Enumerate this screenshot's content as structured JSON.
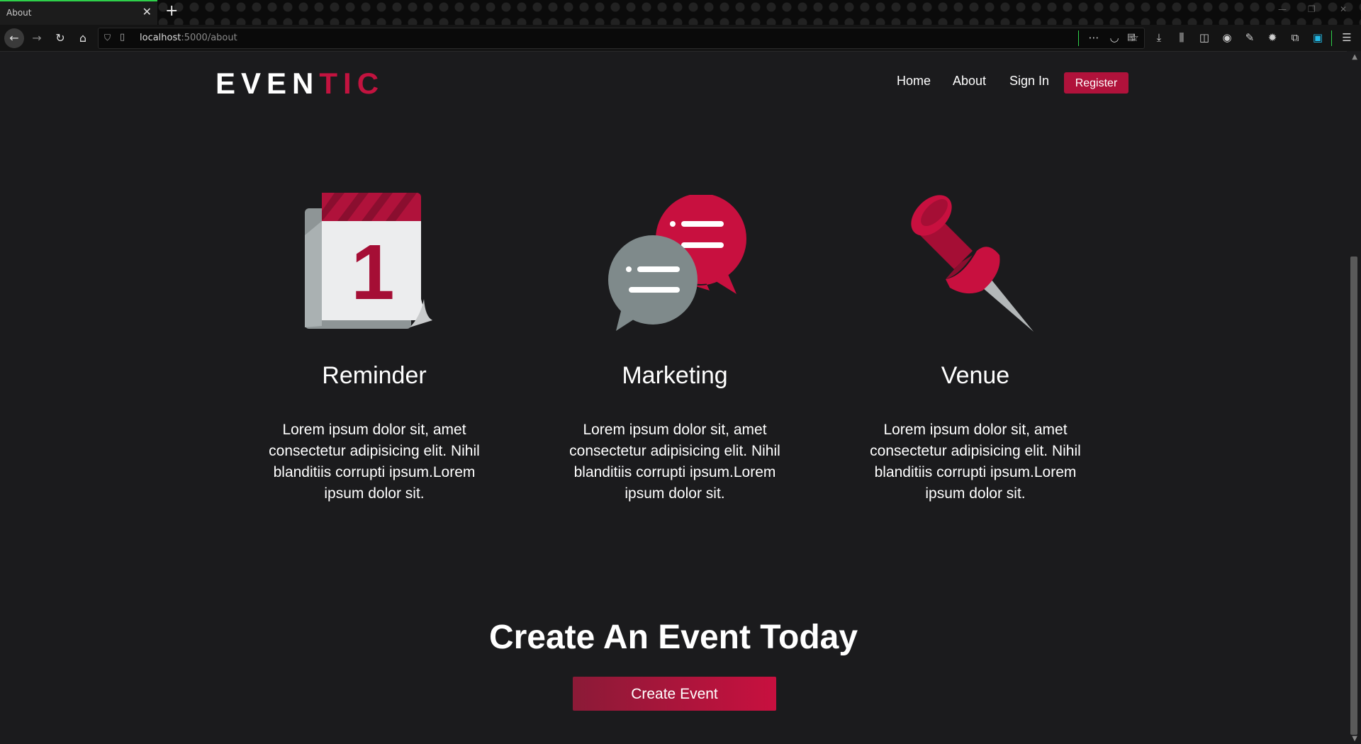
{
  "browser": {
    "tab_title": "About",
    "tab_close": "✕",
    "new_tab": "+",
    "url_host": "localhost",
    "url_path": ":5000/about"
  },
  "brand": {
    "logo_part1": "EVEN",
    "logo_part2": "TIC",
    "accent": "#c2133f"
  },
  "nav": {
    "items": [
      {
        "label": "Home"
      },
      {
        "label": "About"
      },
      {
        "label": "Sign In"
      }
    ],
    "register_label": "Register"
  },
  "features": [
    {
      "title": "Reminder",
      "icon": "calendar-icon",
      "calendar_day": "1",
      "description": "Lorem ipsum dolor sit, amet consectetur adipisicing elit. Nihil blanditiis corrupti ipsum.Lorem ipsum dolor sit."
    },
    {
      "title": "Marketing",
      "icon": "chat-bubbles-icon",
      "description": "Lorem ipsum dolor sit, amet consectetur adipisicing elit. Nihil blanditiis corrupti ipsum.Lorem ipsum dolor sit."
    },
    {
      "title": "Venue",
      "icon": "pushpin-icon",
      "description": "Lorem ipsum dolor sit, amet consectetur adipisicing elit. Nihil blanditiis corrupti ipsum.Lorem ipsum dolor sit."
    }
  ],
  "cta": {
    "title": "Create An Event Today",
    "button_label": "Create Event"
  }
}
